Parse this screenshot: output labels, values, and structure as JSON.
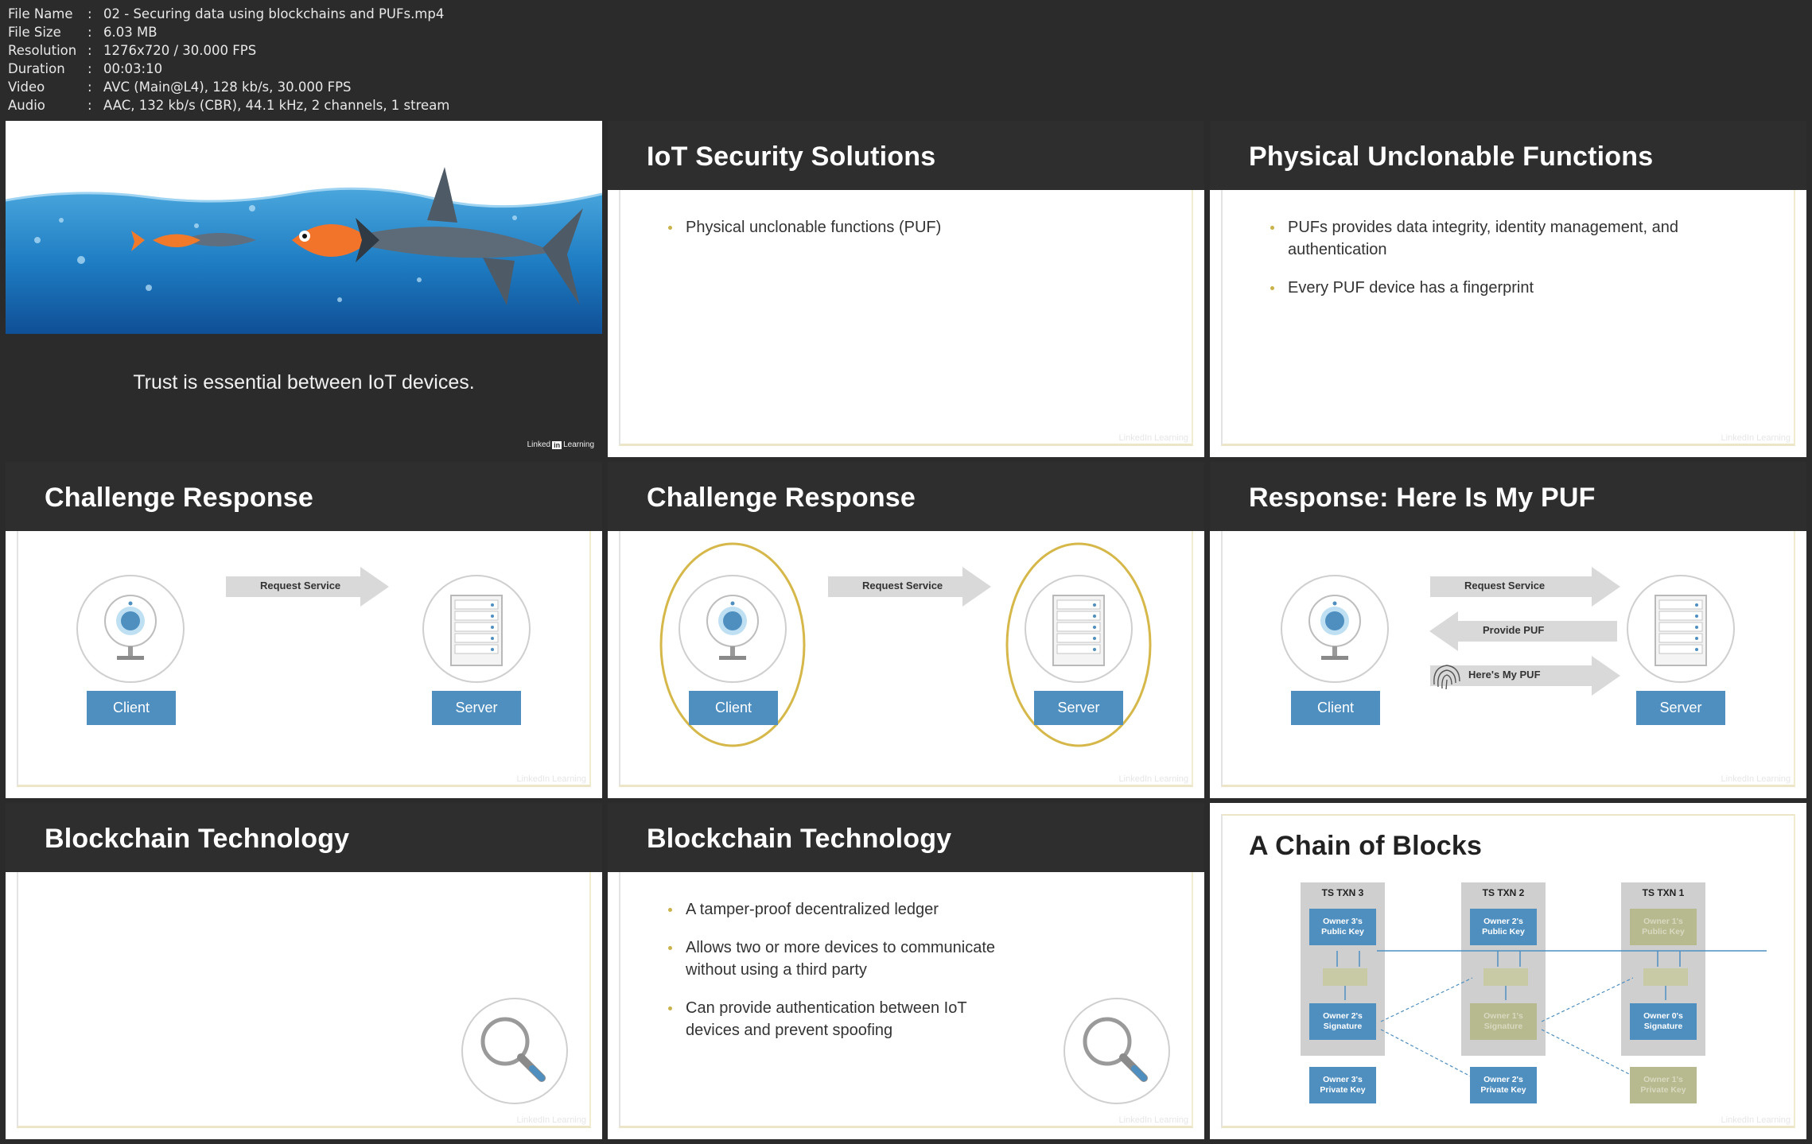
{
  "file_info": [
    {
      "key": "File Name",
      "value": "02 - Securing data using blockchains and PUFs.mp4"
    },
    {
      "key": "File Size",
      "value": "6.03 MB"
    },
    {
      "key": "Resolution",
      "value": "1276x720 / 30.000 FPS"
    },
    {
      "key": "Duration",
      "value": "00:03:10"
    },
    {
      "key": "Video",
      "value": "AVC (Main@L4), 128 kb/s, 30.000 FPS"
    },
    {
      "key": "Audio",
      "value": "AAC, 132 kb/s (CBR), 44.1 kHz, 2 channels, 1 stream"
    }
  ],
  "separator": ":",
  "watermark": "LinkedIn Learning",
  "tiles": {
    "t1": {
      "caption": "Trust is essential between IoT devices.",
      "logo_a": "Linked",
      "logo_b": "in",
      "logo_c": "Learning"
    },
    "t2": {
      "title": "IoT Security Solutions",
      "bullets": [
        "Physical unclonable functions (PUF)"
      ]
    },
    "t3": {
      "title": "Physical Unclonable Functions",
      "bullets": [
        "PUFs provides data integrity, identity management, and authentication",
        "Every PUF device has a fingerprint"
      ]
    },
    "t4": {
      "title": "Challenge Response",
      "arrow": "Request Service",
      "client": "Client",
      "server": "Server"
    },
    "t5": {
      "title": "Challenge Response",
      "arrow": "Request Service",
      "client": "Client",
      "server": "Server"
    },
    "t6": {
      "title": "Response: Here Is My PUF",
      "arrow1": "Request Service",
      "arrow2": "Provide PUF",
      "arrow3": "Here's My PUF",
      "client": "Client",
      "server": "Server"
    },
    "t7": {
      "title": "Blockchain Technology"
    },
    "t8": {
      "title": "Blockchain Technology",
      "bullets": [
        "A tamper-proof decentralized ledger",
        "Allows two or more devices to communicate without using a third party",
        "Can provide authentication between IoT devices and prevent spoofing"
      ]
    },
    "t9": {
      "title": "A Chain of Blocks",
      "blocks": [
        {
          "label": "TS TXN 3",
          "pub": "Owner 3's Public Key",
          "sig": "Owner 2's Signature",
          "priv": "Owner 3's Private Key"
        },
        {
          "label": "TS TXN 2",
          "pub": "Owner 2's Public Key",
          "sig": "Owner 1's Signature",
          "priv": "Owner 2's Private Key"
        },
        {
          "label": "TS TXN 1",
          "pub": "Owner 1's Public Key",
          "sig": "Owner 0's Signature",
          "priv": "Owner 1's Private Key"
        }
      ]
    }
  },
  "colors": {
    "accent_blue": "#4f8fc0",
    "header_dark": "#2e2e2e",
    "gold": "#d6b84a",
    "bullet": "#c9b24a"
  }
}
